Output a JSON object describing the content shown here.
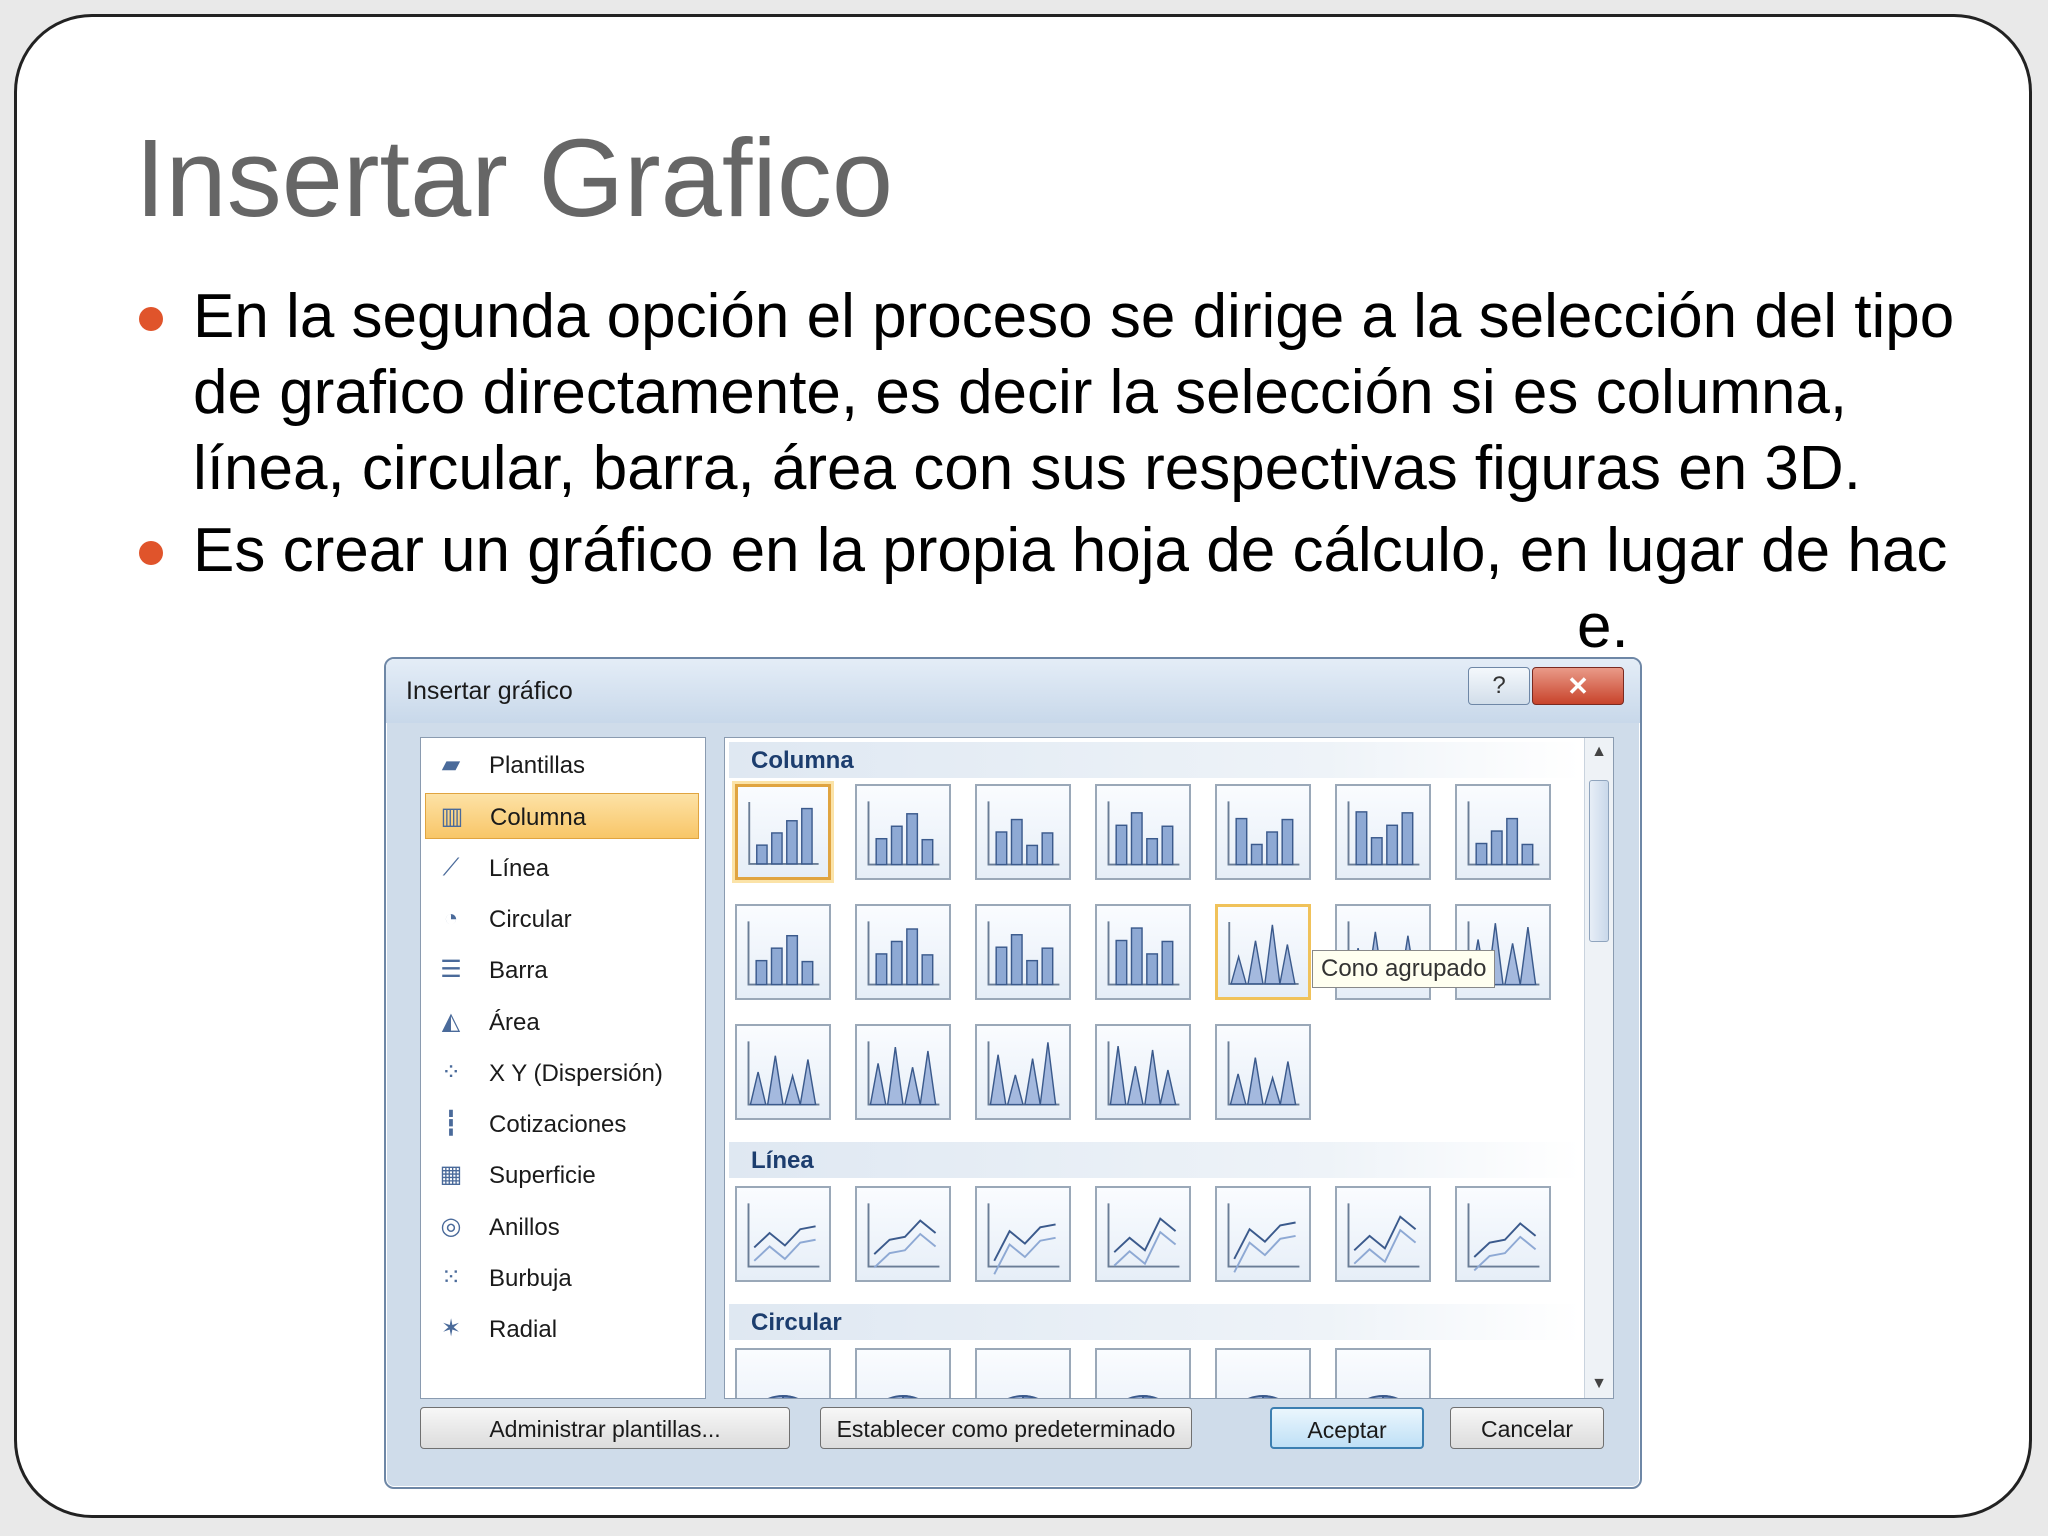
{
  "slide": {
    "title": "Insertar Grafico",
    "bullets": [
      "En la segunda opción el proceso se dirige a la selección del tipo de grafico directamente, es decir la selección si es columna, línea, circular, barra, área con sus respectivas figuras en 3D.",
      "Es crear un gráfico en la propia hoja de cálculo, en lugar de hac"
    ],
    "bullet2_tail": "e."
  },
  "dialog": {
    "title": "Insertar gráfico",
    "help_glyph": "?",
    "close_glyph": "✕",
    "categories": [
      {
        "label": "Plantillas",
        "icon": "folder-icon",
        "glyph": "▰"
      },
      {
        "label": "Columna",
        "icon": "column-chart-icon",
        "glyph": "▥",
        "selected": true
      },
      {
        "label": "Línea",
        "icon": "line-chart-icon",
        "glyph": "⟋"
      },
      {
        "label": "Circular",
        "icon": "pie-chart-icon",
        "glyph": "◔"
      },
      {
        "label": "Barra",
        "icon": "bar-chart-icon",
        "glyph": "☰"
      },
      {
        "label": "Área",
        "icon": "area-chart-icon",
        "glyph": "◭"
      },
      {
        "label": "X Y (Dispersión)",
        "icon": "scatter-chart-icon",
        "glyph": "⁘"
      },
      {
        "label": "Cotizaciones",
        "icon": "stock-chart-icon",
        "glyph": "┇"
      },
      {
        "label": "Superficie",
        "icon": "surface-chart-icon",
        "glyph": "▦"
      },
      {
        "label": "Anillos",
        "icon": "doughnut-chart-icon",
        "glyph": "◎"
      },
      {
        "label": "Burbuja",
        "icon": "bubble-chart-icon",
        "glyph": "⁙"
      },
      {
        "label": "Radial",
        "icon": "radar-chart-icon",
        "glyph": "✶"
      }
    ],
    "sections": {
      "columna": "Columna",
      "linea": "Línea",
      "circular": "Circular"
    },
    "tooltip": "Cono agrupado",
    "buttons": {
      "manage": "Administrar plantillas...",
      "set_default": "Establecer como predeterminado",
      "accept": "Aceptar",
      "cancel": "Cancelar"
    },
    "scroll": {
      "up": "▲",
      "down": "▼"
    }
  }
}
